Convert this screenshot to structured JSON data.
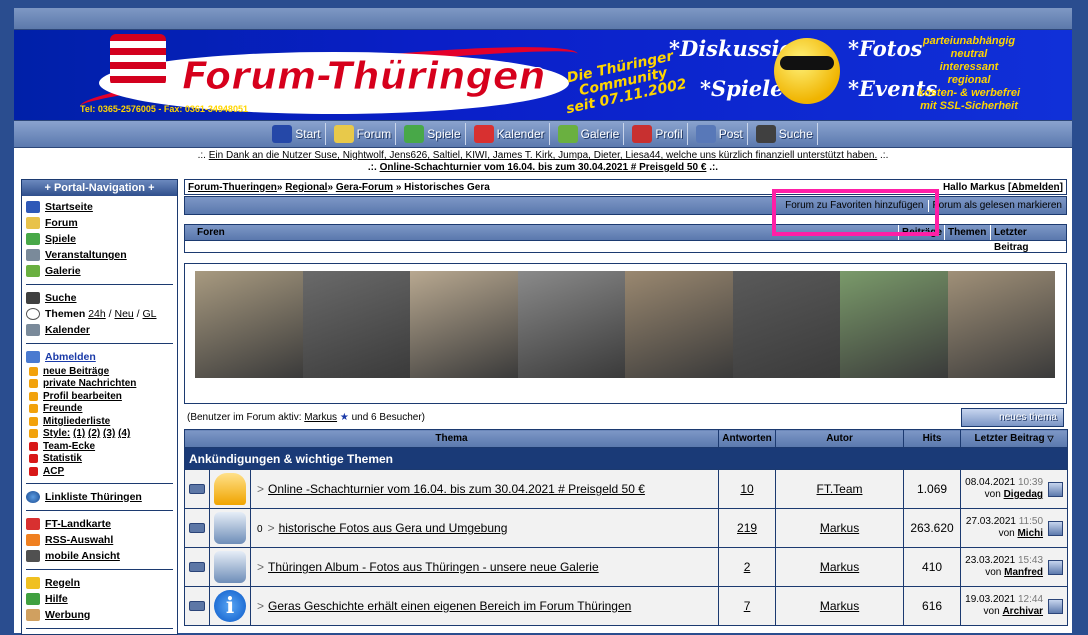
{
  "banner": {
    "title": "Forum-Thüringen",
    "slogan_1": "Die Thüringer",
    "slogan_2": "Community",
    "slogan_3": "seit 07.11.2002",
    "phone": "Tel: 0365-2576005 - Fax: 0361-34948051",
    "tag_diskussion": "*Diskussion",
    "tag_spiele": "*Spiele",
    "tag_fotos": "*Fotos",
    "tag_events": "*Events",
    "right_text": [
      "parteiunabhängig",
      "neutral",
      "interessant",
      "regional",
      "kosten- & werbefrei",
      "mit SSL-Sicherheit"
    ]
  },
  "nav": [
    {
      "label": "Start",
      "color": "#2548a8"
    },
    {
      "label": "Forum",
      "color": "#e8c94a"
    },
    {
      "label": "Spiele",
      "color": "#48a848"
    },
    {
      "label": "Kalender",
      "color": "#d83030"
    },
    {
      "label": "Galerie",
      "color": "#6ab040"
    },
    {
      "label": "Profil",
      "color": "#c83030"
    },
    {
      "label": "Post",
      "color": "#5878b8"
    },
    {
      "label": "Suche",
      "color": "#404040"
    }
  ],
  "notice": {
    "line1_prefix": ".:.",
    "line1_link": "Ein Dank an die Nutzer Suse, Nightwolf, Jens626, Saltiel, KIWI, James T. Kirk, Jumpa, Dieter, Liesa44, welche uns kürzlich finanziell unterstützt haben.",
    "line1_suffix": ".:.",
    "line2_prefix": ".:.",
    "line2_link": "Online-Schachturnier vom 16.04. bis zum 30.04.2021 # Preisgeld 50 €",
    "line2_suffix": ".:."
  },
  "sidebar": {
    "title": "+ Portal-Navigation +",
    "group1": [
      {
        "label": "Startseite",
        "color": "#2f59b8"
      },
      {
        "label": "Forum",
        "color": "#e8c24a"
      },
      {
        "label": "Spiele",
        "color": "#48a848"
      },
      {
        "label": "Veranstaltungen",
        "color": "#7a8a9a"
      },
      {
        "label": "Galerie",
        "color": "#6ab040"
      }
    ],
    "search_label": "Suche",
    "themen_label": "Themen",
    "themen_links": [
      "24h",
      "Neu",
      "GL"
    ],
    "kalender_label": "Kalender",
    "abmelden_label": "Abmelden",
    "sub_items": [
      "neue Beiträge",
      "private Nachrichten",
      "Profil bearbeiten",
      "Freunde",
      "Mitgliederliste"
    ],
    "style_label": "Style:",
    "style_links": [
      "(1)",
      "(2)",
      "(3)",
      "(4)"
    ],
    "sub_items_red": [
      "Team-Ecke",
      "Statistik",
      "ACP"
    ],
    "linkliste_label": "Linkliste Thüringen",
    "group4": [
      {
        "label": "FT-Landkarte",
        "color": "#d83030"
      },
      {
        "label": "RSS-Auswahl",
        "color": "#f08020"
      },
      {
        "label": "mobile Ansicht",
        "color": "#505050"
      }
    ],
    "group5": [
      {
        "label": "Regeln",
        "color": "#f0c020"
      },
      {
        "label": "Hilfe",
        "color": "#40a040"
      },
      {
        "label": "Werbung",
        "color": "#d0a060"
      }
    ]
  },
  "breadcrumb": {
    "items": [
      "Forum-Thueringen",
      "Regional",
      "Gera-Forum"
    ],
    "separator": "»",
    "current": "Historisches Gera",
    "greeting_prefix": "Hallo Markus [",
    "logout": "Abmelden",
    "greeting_suffix": "]"
  },
  "toolbar": {
    "fav": "Forum zu Favoriten hinzufügen",
    "read": "Forum als gelesen markieren"
  },
  "foren_header": {
    "foren": "Foren",
    "beitraege": "Beiträge",
    "themen": "Themen",
    "letzter": "Letzter Beitrag"
  },
  "photo_colors": [
    "#a89a80",
    "#6a6a6a",
    "#b8a890",
    "#8a8a8a",
    "#9a8870",
    "#5a5a5a",
    "#7a9a6a",
    "#a09078"
  ],
  "active": {
    "prefix": "(Benutzer im Forum aktiv:",
    "user": "Markus",
    "suffix": "und 6 Besucher)",
    "new_topic": "neues thema"
  },
  "table": {
    "headers": {
      "thema": "Thema",
      "antworten": "Antworten",
      "autor": "Autor",
      "hits": "Hits",
      "letzter": "Letzter Beitrag"
    },
    "section": "Ankündigungen & wichtige Themen",
    "rows": [
      {
        "icon": "thumb",
        "title": "Online -Schachturnier vom 16.04. bis zum 30.04.2021 # Preisgeld 50 €",
        "clip": "",
        "replies": "10",
        "author": "FT.Team",
        "hits": "1.069",
        "date": "08.04.2021",
        "time": "10:39",
        "by": "von",
        "last_user": "Digedag"
      },
      {
        "icon": "cam",
        "title": "historische Fotos aus Gera und Umgebung",
        "clip": "0",
        "replies": "219",
        "author": "Markus",
        "hits": "263.620",
        "date": "27.03.2021",
        "time": "11:50",
        "by": "von",
        "last_user": "Michi"
      },
      {
        "icon": "cam",
        "title": "Thüringen Album - Fotos aus Thüringen - unsere neue Galerie",
        "clip": "",
        "replies": "2",
        "author": "Markus",
        "hits": "410",
        "date": "23.03.2021",
        "time": "15:43",
        "by": "von",
        "last_user": "Manfred"
      },
      {
        "icon": "info",
        "title": "Geras Geschichte erhält einen eigenen Bereich im Forum Thüringen",
        "clip": "",
        "replies": "7",
        "author": "Markus",
        "hits": "616",
        "date": "19.03.2021",
        "time": "12:44",
        "by": "von",
        "last_user": "Archivar"
      }
    ]
  }
}
